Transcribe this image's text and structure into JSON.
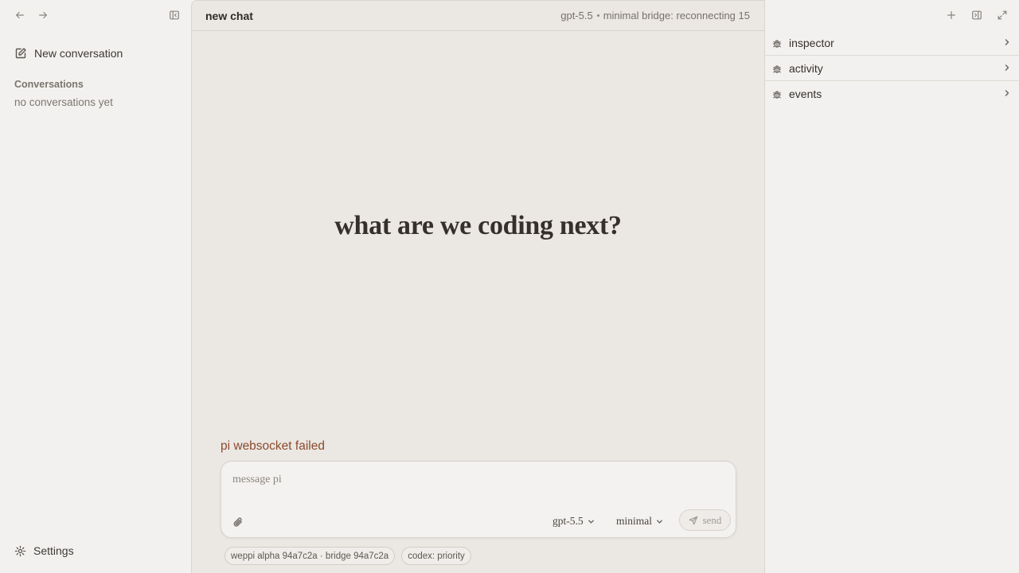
{
  "sidebar": {
    "icons": {
      "back": "arrow-left-icon",
      "forward": "arrow-right-icon",
      "toggle": "sidebar-toggle-icon"
    },
    "new_conversation_label": "New conversation",
    "conversations_heading": "Conversations",
    "conversations_empty": "no conversations yet",
    "settings_label": "Settings"
  },
  "main": {
    "title": "new chat",
    "model_status": "gpt-5.5",
    "bridge_status": "minimal bridge: reconnecting 15",
    "hero_text": "what are we coding next?",
    "error_text": "pi websocket failed",
    "composer": {
      "placeholder": "message pi",
      "value": "",
      "model_select": "gpt-5.5",
      "mode_select": "minimal",
      "send_label": "send"
    },
    "chips": [
      "weppi alpha 94a7c2a · bridge 94a7c2a",
      "codex: priority"
    ]
  },
  "right_panel": {
    "icons": {
      "add": "plus-icon",
      "panel": "panel-right-icon",
      "expand": "expand-icon"
    },
    "sections": [
      {
        "label": "inspector"
      },
      {
        "label": "activity"
      },
      {
        "label": "events"
      }
    ]
  },
  "colors": {
    "background": "#f3f1ef",
    "main_background": "#ebe7e3",
    "error": "#8a4a2e",
    "text": "#3a3632"
  }
}
